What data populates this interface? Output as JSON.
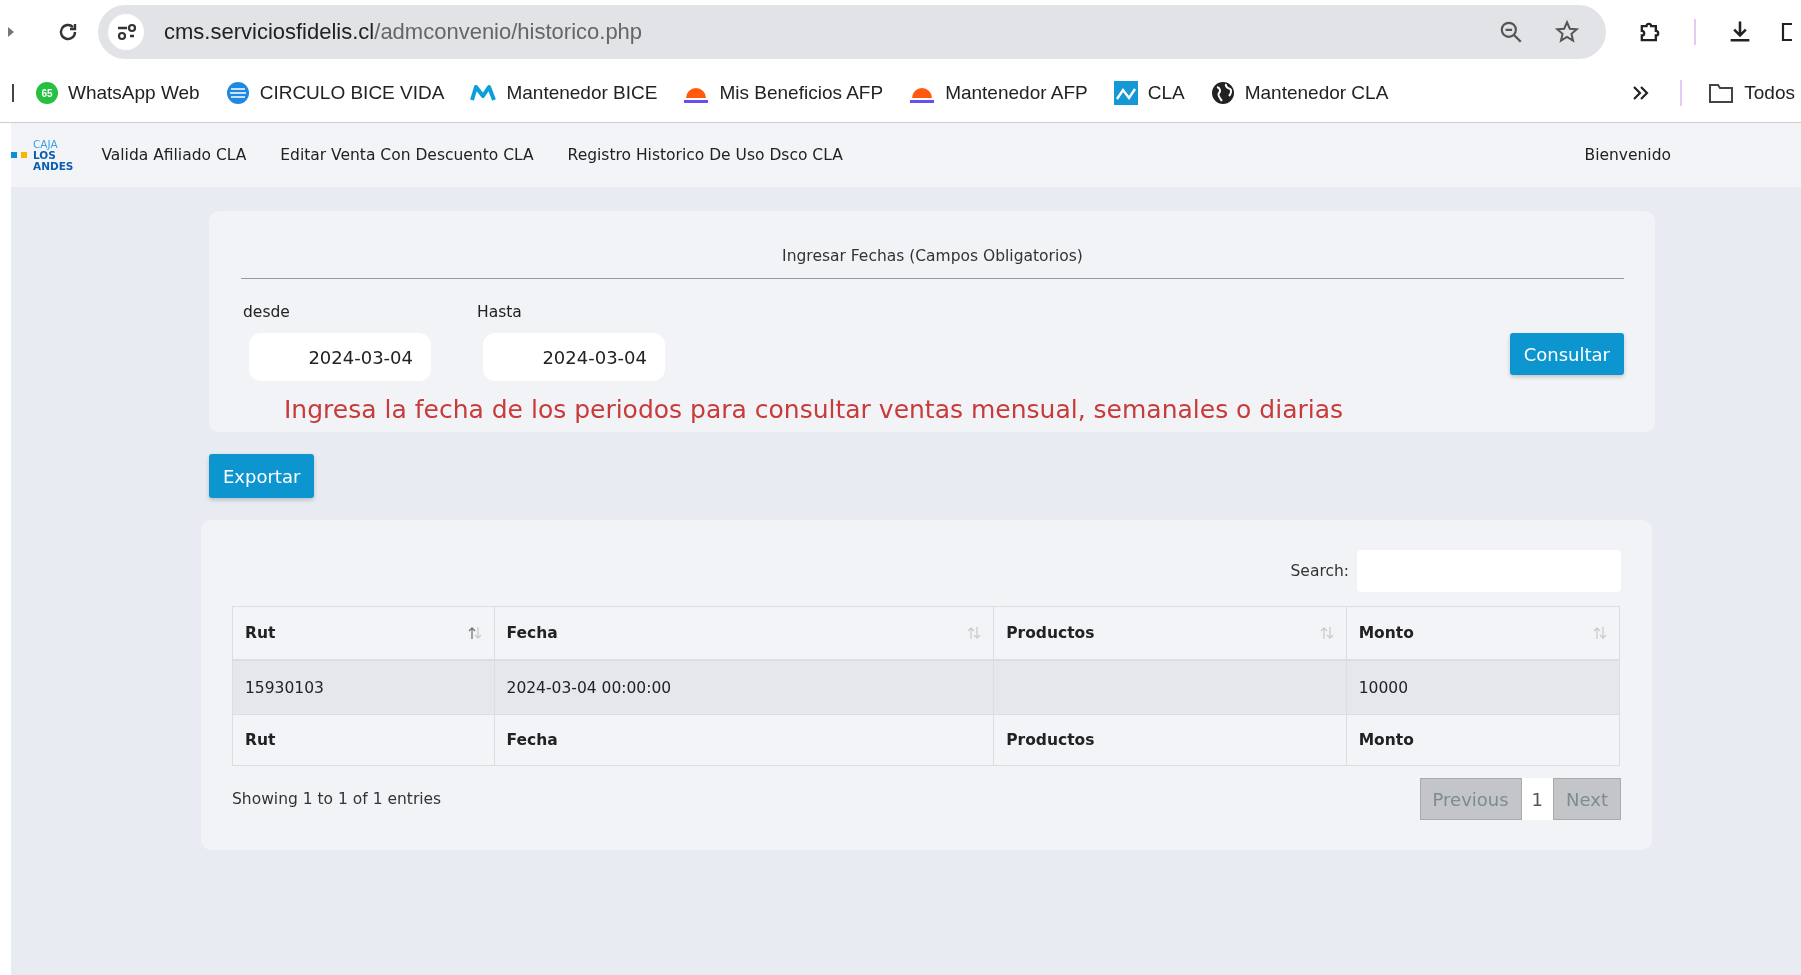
{
  "browser": {
    "url_host": "cms.serviciosfidelis.cl",
    "url_path": "/admconvenio/historico.php",
    "bookmarks": [
      {
        "kind": "whatsapp",
        "badge": "65",
        "label": "WhatsApp Web"
      },
      {
        "kind": "stripes",
        "label": "CIRCULO BICE VIDA"
      },
      {
        "kind": "m-logo",
        "label": "Mantenedor BICE"
      },
      {
        "kind": "dome",
        "label": "Mis Beneficios AFP"
      },
      {
        "kind": "dome",
        "label": "Mantenedor AFP"
      },
      {
        "kind": "wave-square",
        "label": "CLA"
      },
      {
        "kind": "globe",
        "label": "Mantenedor CLA"
      }
    ],
    "folder": "Todos"
  },
  "nav": {
    "logo": [
      "CAJA",
      "LOS",
      "ANDES"
    ],
    "links": [
      "Valida Afiliado CLA",
      "Editar Venta Con Descuento CLA",
      "Registro Historico De Uso Dsco CLA"
    ],
    "welcome": "Bienvenido"
  },
  "form": {
    "title": "Ingresar Fechas (Campos Obligatorios)",
    "from_label": "desde",
    "from_value": "2024-03-04",
    "to_label": "Hasta",
    "to_value": "2024-03-04",
    "submit": "Consultar",
    "hint": "Ingresa la fecha de los periodos para consultar ventas mensual, semanales o diarias"
  },
  "export_button": "Exportar",
  "table": {
    "search_label": "Search:",
    "columns": [
      "Rut",
      "Fecha",
      "Productos",
      "Monto"
    ],
    "rows": [
      [
        "15930103",
        "2024-03-04 00:00:00",
        "",
        "10000"
      ]
    ],
    "footer": [
      "Rut",
      "Fecha",
      "Productos",
      "Monto"
    ],
    "info": "Showing 1 to 1 of 1 entries",
    "pagination": [
      {
        "label": "Previous",
        "kind": "nav",
        "disabled": true,
        "selected": false
      },
      {
        "label": "1",
        "kind": "page",
        "disabled": false,
        "selected": true
      },
      {
        "label": "Next",
        "kind": "nav",
        "disabled": true,
        "selected": false
      }
    ]
  }
}
